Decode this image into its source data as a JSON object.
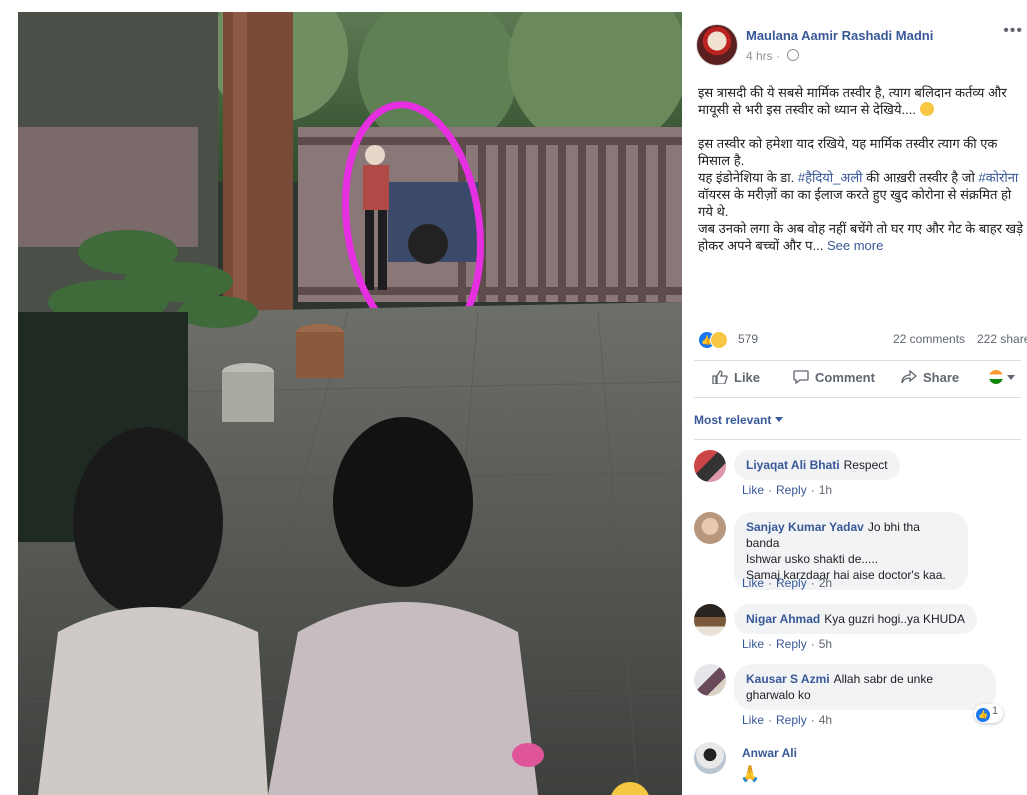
{
  "post": {
    "author_name": "Maulana Aamir Rashadi Madni",
    "time": "4 hrs",
    "more_icon": "more-dots-icon",
    "text_p1": "इस त्रासदी की ये सबसे मार्मिक तस्वीर है, त्याग बलिदान कर्तव्य और मायूसी से भरी इस तस्वीर को ध्यान से देखिये....",
    "text_p2_line1": "इस तस्वीर को हमेशा याद रखिये, यह मार्मिक तस्वीर त्याग की एक मिसाल है.",
    "text_p2_line2_before": "यह इंडोनेशिया के डा. ",
    "text_p2_hashtag1": "#हैदियो_अली",
    "text_p2_line2_after": " की आख़री तस्वीर है जो",
    "text_p2_hashtag2": "#कोरोना",
    "text_p2_line3_after": " वॉयरस के मरीज़ों का का ईलाज करते हुए खुद कोरोना से संक्रमित हो गये थे.",
    "text_p2_line4": "जब उनको लगा के अब वोह नहीं बचेंगे तो घर गए और गेट के बाहर खड़े होकर अपने बच्चों और प...",
    "see_more": "See more"
  },
  "reactions": {
    "count": "579",
    "comments": "22 comments",
    "shares": "222 shares"
  },
  "actions": {
    "like": "Like",
    "comment": "Comment",
    "share": "Share"
  },
  "sort": {
    "label": "Most relevant"
  },
  "comments": [
    {
      "name": "Liyaqat Ali Bhati",
      "text": "Respect",
      "like": "Like",
      "reply": "Reply",
      "time": "1h"
    },
    {
      "name": "Sanjay Kumar Yadav",
      "text1": "Jo bhi tha banda",
      "text2": "Ishwar usko shakti de.....",
      "text3": "Samaj karzdaar hai aise doctor's kaa.",
      "like": "Like",
      "reply": "Reply",
      "time": "2h"
    },
    {
      "name": "Nigar Ahmad",
      "text": "Kya guzri hogi..ya KHUDA",
      "like": "Like",
      "reply": "Reply",
      "time": "5h"
    },
    {
      "name": "Kausar S Azmi",
      "text1": "Allah sabr de unke",
      "text2": "gharwalo ko",
      "like": "Like",
      "reply": "Reply",
      "time": "4h",
      "reaction_count": "1"
    },
    {
      "name": "Anwar Ali"
    }
  ],
  "colors": {
    "link": "#385898",
    "like_blue": "#1877f2",
    "ring": "#e52fe0"
  }
}
